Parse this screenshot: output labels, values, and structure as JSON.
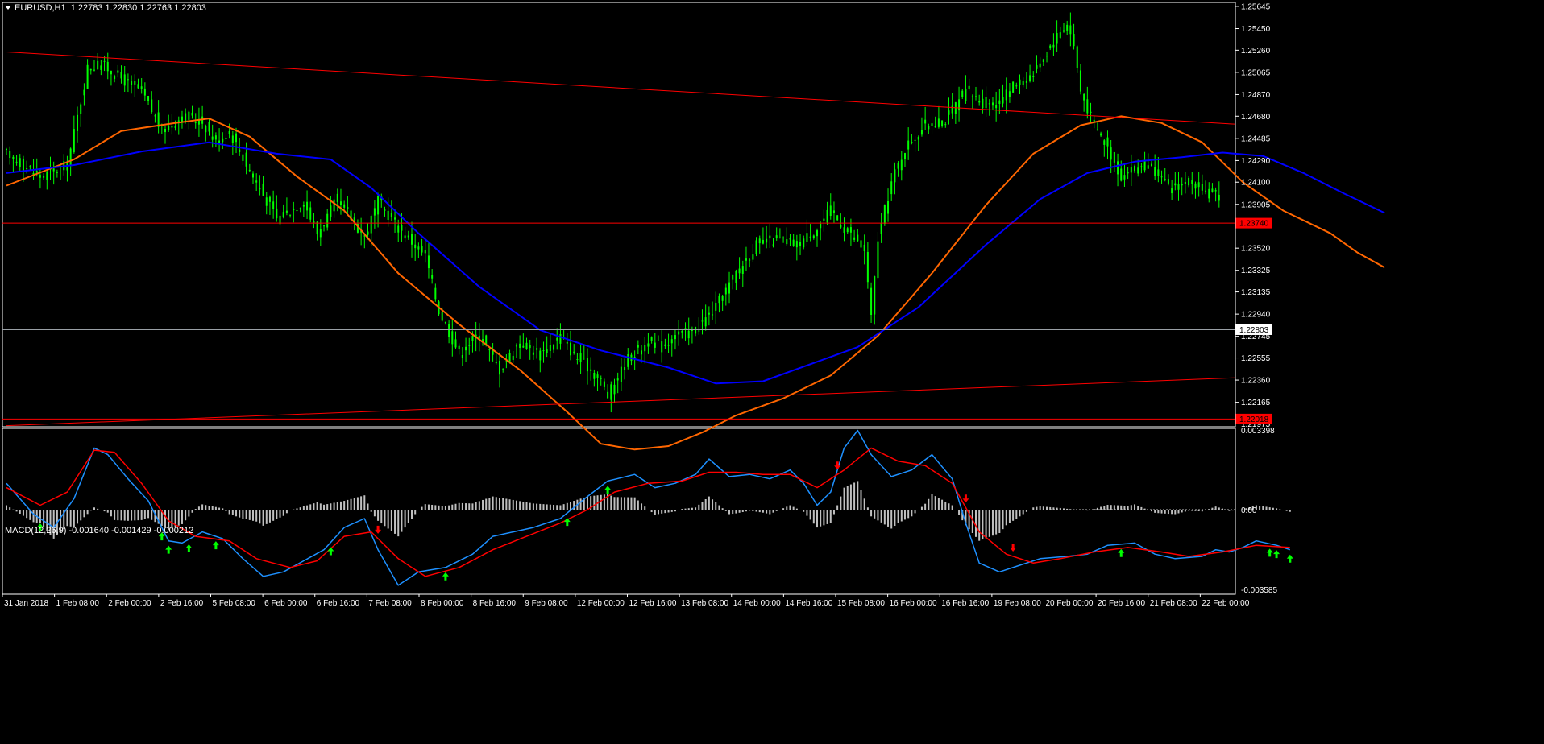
{
  "header": {
    "symbol": "EURUSD,H1",
    "ohlc": "1.22783 1.22830 1.22763 1.22803"
  },
  "macd": {
    "label": "MACD(12,26,9) -0.001640 -0.001429 -0.000212",
    "scale_labels": [
      "0.003398",
      "0.00",
      "-0.003585"
    ]
  },
  "colors": {
    "background": "#000000",
    "axis": "#ffffff",
    "candles": "#00ff00",
    "ma_fast": "#ff6600",
    "ma_slow": "#0000ff",
    "trendline": "#ff0000",
    "current_price_line": "#9aa0a6",
    "macd_main": "#1e90ff",
    "macd_signal": "#ff0000",
    "histogram": "#c0c0c0",
    "arrow_up": "#00ff00",
    "arrow_down": "#ff0000"
  },
  "chart_data": [
    {
      "type": "candlestick",
      "title": "EURUSD,H1",
      "x_tick_labels": [
        "31 Jan 2018",
        "1 Feb 08:00",
        "2 Feb 00:00",
        "2 Feb 16:00",
        "5 Feb 08:00",
        "6 Feb 00:00",
        "6 Feb 16:00",
        "7 Feb 08:00",
        "8 Feb 00:00",
        "8 Feb 16:00",
        "9 Feb 08:00",
        "12 Feb 00:00",
        "12 Feb 16:00",
        "13 Feb 08:00",
        "14 Feb 00:00",
        "14 Feb 16:00",
        "15 Feb 08:00",
        "16 Feb 00:00",
        "16 Feb 16:00",
        "19 Feb 08:00",
        "20 Feb 00:00",
        "20 Feb 16:00",
        "21 Feb 08:00",
        "22 Feb 00:00"
      ],
      "y_tick_labels": [
        "1.25645",
        "1.25450",
        "1.25260",
        "1.25065",
        "1.24870",
        "1.24680",
        "1.24485",
        "1.24290",
        "1.24100",
        "1.23905",
        "1.23520",
        "1.23325",
        "1.23135",
        "1.22940",
        "1.22745",
        "1.22555",
        "1.22360",
        "1.22165",
        "1.21975"
      ],
      "ylim": [
        1.2195,
        1.2568
      ],
      "n_bars": 360,
      "close_path": [
        [
          0,
          1.2435
        ],
        [
          10,
          1.2415
        ],
        [
          18,
          1.2425
        ],
        [
          24,
          1.251
        ],
        [
          28,
          1.2514
        ],
        [
          36,
          1.2497
        ],
        [
          40,
          1.249
        ],
        [
          46,
          1.2455
        ],
        [
          52,
          1.2468
        ],
        [
          58,
          1.2463
        ],
        [
          62,
          1.2445
        ],
        [
          66,
          1.2455
        ],
        [
          72,
          1.242
        ],
        [
          80,
          1.2378
        ],
        [
          88,
          1.2393
        ],
        [
          92,
          1.2365
        ],
        [
          98,
          1.2395
        ],
        [
          106,
          1.2362
        ],
        [
          110,
          1.2393
        ],
        [
          116,
          1.237
        ],
        [
          124,
          1.2345
        ],
        [
          128,
          1.2297
        ],
        [
          134,
          1.226
        ],
        [
          140,
          1.2277
        ],
        [
          146,
          1.2245
        ],
        [
          152,
          1.227
        ],
        [
          158,
          1.2258
        ],
        [
          164,
          1.2275
        ],
        [
          168,
          1.2258
        ],
        [
          172,
          1.2248
        ],
        [
          176,
          1.2235
        ],
        [
          178,
          1.2222
        ],
        [
          184,
          1.2255
        ],
        [
          190,
          1.227
        ],
        [
          194,
          1.2265
        ],
        [
          198,
          1.2275
        ],
        [
          204,
          1.228
        ],
        [
          210,
          1.23
        ],
        [
          216,
          1.233
        ],
        [
          222,
          1.2355
        ],
        [
          228,
          1.236
        ],
        [
          234,
          1.2355
        ],
        [
          240,
          1.237
        ],
        [
          244,
          1.2385
        ],
        [
          248,
          1.237
        ],
        [
          254,
          1.235
        ],
        [
          256,
          1.229
        ],
        [
          258,
          1.236
        ],
        [
          262,
          1.241
        ],
        [
          266,
          1.244
        ],
        [
          272,
          1.246
        ],
        [
          278,
          1.2465
        ],
        [
          284,
          1.249
        ],
        [
          290,
          1.2478
        ],
        [
          294,
          1.248
        ],
        [
          298,
          1.2495
        ],
        [
          304,
          1.2505
        ],
        [
          310,
          1.2535
        ],
        [
          314,
          1.255
        ],
        [
          316,
          1.253
        ],
        [
          318,
          1.249
        ],
        [
          322,
          1.246
        ],
        [
          326,
          1.244
        ],
        [
          330,
          1.2415
        ],
        [
          336,
          1.2425
        ],
        [
          340,
          1.242
        ],
        [
          344,
          1.2405
        ],
        [
          350,
          1.241
        ],
        [
          356,
          1.24
        ],
        [
          362,
          1.2395
        ],
        [
          366,
          1.238
        ],
        [
          370,
          1.236
        ],
        [
          376,
          1.235
        ],
        [
          380,
          1.2345
        ],
        [
          386,
          1.234
        ],
        [
          390,
          1.2335
        ],
        [
          396,
          1.233
        ],
        [
          400,
          1.232
        ],
        [
          404,
          1.2328
        ],
        [
          408,
          1.2315
        ],
        [
          410,
          1.23
        ],
        [
          414,
          1.2285
        ],
        [
          418,
          1.228
        ]
      ],
      "ma_fast": [
        [
          0,
          1.2407
        ],
        [
          20,
          1.243
        ],
        [
          34,
          1.2455
        ],
        [
          50,
          1.2462
        ],
        [
          60,
          1.2466
        ],
        [
          72,
          1.245
        ],
        [
          86,
          1.2415
        ],
        [
          100,
          1.2385
        ],
        [
          116,
          1.233
        ],
        [
          134,
          1.2285
        ],
        [
          152,
          1.2245
        ],
        [
          166,
          1.2208
        ],
        [
          176,
          1.218
        ],
        [
          186,
          1.2175
        ],
        [
          196,
          1.2178
        ],
        [
          206,
          1.219
        ],
        [
          216,
          1.2205
        ],
        [
          230,
          1.222
        ],
        [
          244,
          1.224
        ],
        [
          258,
          1.2275
        ],
        [
          274,
          1.233
        ],
        [
          290,
          1.239
        ],
        [
          304,
          1.2435
        ],
        [
          318,
          1.246
        ],
        [
          330,
          1.2468
        ],
        [
          342,
          1.2462
        ],
        [
          354,
          1.2445
        ],
        [
          366,
          1.241
        ],
        [
          378,
          1.2385
        ],
        [
          392,
          1.2365
        ],
        [
          400,
          1.2348
        ],
        [
          408,
          1.2335
        ]
      ],
      "ma_slow": [
        [
          0,
          1.2418
        ],
        [
          20,
          1.2425
        ],
        [
          40,
          1.2437
        ],
        [
          60,
          1.2445
        ],
        [
          80,
          1.2435
        ],
        [
          96,
          1.243
        ],
        [
          108,
          1.2405
        ],
        [
          122,
          1.2365
        ],
        [
          140,
          1.2318
        ],
        [
          158,
          1.228
        ],
        [
          176,
          1.2262
        ],
        [
          196,
          1.2247
        ],
        [
          210,
          1.2233
        ],
        [
          224,
          1.2235
        ],
        [
          238,
          1.225
        ],
        [
          252,
          1.2265
        ],
        [
          270,
          1.23
        ],
        [
          290,
          1.2355
        ],
        [
          306,
          1.2395
        ],
        [
          320,
          1.2418
        ],
        [
          334,
          1.2428
        ],
        [
          348,
          1.2432
        ],
        [
          360,
          1.2436
        ],
        [
          372,
          1.2433
        ],
        [
          384,
          1.2418
        ],
        [
          396,
          1.24
        ],
        [
          408,
          1.2383
        ]
      ],
      "levels": {
        "horizontal_red": 1.2374,
        "bottom_red": 1.22018,
        "current_price": 1.22803
      },
      "price_tags": [
        "1.23740",
        "1.22803",
        "1.22018"
      ],
      "trendlines": [
        {
          "from": [
            0,
            1.25245
          ],
          "to": [
            418,
            1.2461
          ]
        },
        {
          "from": [
            0,
            1.2196
          ],
          "to": [
            418,
            1.2238
          ]
        }
      ]
    },
    {
      "type": "macd",
      "title": "MACD(12,26,9) -0.001640 -0.001429 -0.000212",
      "ylim": [
        -0.003585,
        0.003398
      ],
      "main": [
        [
          0,
          0.0012
        ],
        [
          8,
          -0.0002
        ],
        [
          14,
          -0.0008
        ],
        [
          20,
          0.0005
        ],
        [
          26,
          0.0028
        ],
        [
          30,
          0.0025
        ],
        [
          36,
          0.0014
        ],
        [
          42,
          0.0004
        ],
        [
          48,
          -0.0014
        ],
        [
          52,
          -0.0015
        ],
        [
          58,
          -0.001
        ],
        [
          64,
          -0.0013
        ],
        [
          70,
          -0.0022
        ],
        [
          76,
          -0.003
        ],
        [
          82,
          -0.0028
        ],
        [
          88,
          -0.0023
        ],
        [
          94,
          -0.0018
        ],
        [
          100,
          -0.0008
        ],
        [
          106,
          -0.0004
        ],
        [
          110,
          -0.0018
        ],
        [
          116,
          -0.0034
        ],
        [
          122,
          -0.0028
        ],
        [
          130,
          -0.0026
        ],
        [
          138,
          -0.002
        ],
        [
          144,
          -0.0012
        ],
        [
          150,
          -0.001
        ],
        [
          156,
          -0.0008
        ],
        [
          164,
          -0.0004
        ],
        [
          172,
          0.0006
        ],
        [
          178,
          0.0013
        ],
        [
          186,
          0.0016
        ],
        [
          192,
          0.001
        ],
        [
          198,
          0.0012
        ],
        [
          204,
          0.0016
        ],
        [
          208,
          0.0023
        ],
        [
          214,
          0.0015
        ],
        [
          220,
          0.0016
        ],
        [
          226,
          0.0014
        ],
        [
          232,
          0.0018
        ],
        [
          236,
          0.0012
        ],
        [
          240,
          0.0002
        ],
        [
          244,
          0.0008
        ],
        [
          248,
          0.0028
        ],
        [
          252,
          0.0036
        ],
        [
          256,
          0.0025
        ],
        [
          262,
          0.0015
        ],
        [
          268,
          0.0018
        ],
        [
          274,
          0.0025
        ],
        [
          280,
          0.0014
        ],
        [
          284,
          -0.0006
        ],
        [
          288,
          -0.0024
        ],
        [
          294,
          -0.0028
        ],
        [
          300,
          -0.0025
        ],
        [
          306,
          -0.0022
        ],
        [
          314,
          -0.0021
        ],
        [
          320,
          -0.002
        ],
        [
          326,
          -0.0016
        ],
        [
          334,
          -0.0015
        ],
        [
          340,
          -0.002
        ],
        [
          346,
          -0.0022
        ],
        [
          354,
          -0.0021
        ],
        [
          358,
          -0.0018
        ],
        [
          362,
          -0.0019
        ],
        [
          366,
          -0.0017
        ],
        [
          370,
          -0.0014
        ],
        [
          376,
          -0.0016
        ],
        [
          380,
          -0.0018
        ]
      ],
      "signal": [
        [
          0,
          0.001
        ],
        [
          10,
          0.0002
        ],
        [
          18,
          0.0008
        ],
        [
          26,
          0.0027
        ],
        [
          32,
          0.0026
        ],
        [
          40,
          0.0012
        ],
        [
          48,
          -0.0005
        ],
        [
          56,
          -0.0012
        ],
        [
          66,
          -0.0014
        ],
        [
          74,
          -0.0022
        ],
        [
          84,
          -0.0026
        ],
        [
          92,
          -0.0023
        ],
        [
          100,
          -0.0012
        ],
        [
          108,
          -0.001
        ],
        [
          116,
          -0.0022
        ],
        [
          124,
          -0.003
        ],
        [
          134,
          -0.0026
        ],
        [
          144,
          -0.0018
        ],
        [
          154,
          -0.0012
        ],
        [
          164,
          -0.0006
        ],
        [
          172,
          0.0
        ],
        [
          180,
          0.0008
        ],
        [
          190,
          0.0012
        ],
        [
          200,
          0.0013
        ],
        [
          208,
          0.0017
        ],
        [
          216,
          0.0017
        ],
        [
          224,
          0.0016
        ],
        [
          232,
          0.0016
        ],
        [
          240,
          0.001
        ],
        [
          248,
          0.0018
        ],
        [
          256,
          0.0028
        ],
        [
          264,
          0.0022
        ],
        [
          272,
          0.002
        ],
        [
          280,
          0.0012
        ],
        [
          288,
          -0.001
        ],
        [
          296,
          -0.002
        ],
        [
          304,
          -0.0024
        ],
        [
          312,
          -0.0022
        ],
        [
          322,
          -0.0019
        ],
        [
          332,
          -0.0017
        ],
        [
          342,
          -0.0019
        ],
        [
          350,
          -0.0021
        ],
        [
          360,
          -0.0019
        ],
        [
          370,
          -0.0016
        ],
        [
          380,
          -0.0017
        ]
      ],
      "arrows_up": [
        10,
        46,
        48,
        54,
        62,
        96,
        130,
        166,
        178,
        330,
        374,
        376,
        380
      ],
      "arrows_down": [
        110,
        246,
        284,
        298
      ]
    }
  ]
}
